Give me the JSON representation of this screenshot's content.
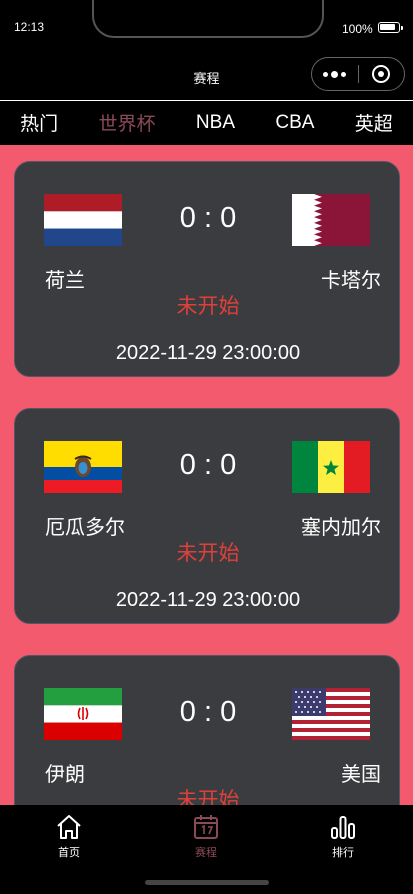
{
  "status_bar": {
    "time": "12:13",
    "battery": "100%"
  },
  "nav": {
    "title": "赛程"
  },
  "tabs": [
    {
      "label": "热门",
      "active": false
    },
    {
      "label": "世界杯",
      "active": true
    },
    {
      "label": "NBA",
      "active": false
    },
    {
      "label": "CBA",
      "active": false
    },
    {
      "label": "英超",
      "active": false
    }
  ],
  "matches": [
    {
      "home": "荷兰",
      "away": "卡塔尔",
      "score": "0 : 0",
      "status": "未开始",
      "date": "2022-11-29 23:00:00",
      "home_flag": "netherlands-flag-icon",
      "away_flag": "qatar-flag-icon"
    },
    {
      "home": "厄瓜多尔",
      "away": "塞内加尔",
      "score": "0 : 0",
      "status": "未开始",
      "date": "2022-11-29 23:00:00",
      "home_flag": "ecuador-flag-icon",
      "away_flag": "senegal-flag-icon"
    },
    {
      "home": "伊朗",
      "away": "美国",
      "score": "0 : 0",
      "status": "未开始",
      "date": "",
      "home_flag": "iran-flag-icon",
      "away_flag": "usa-flag-icon"
    }
  ],
  "tabbar": {
    "items": [
      {
        "label": "首页",
        "icon": "home-icon",
        "active": false
      },
      {
        "label": "赛程",
        "icon": "calendar-icon",
        "active": true
      },
      {
        "label": "排行",
        "icon": "ranking-icon",
        "active": false
      }
    ]
  },
  "colors": {
    "background": "#000000",
    "content_bg": "#f45a6e",
    "card_bg": "#3b3c3f",
    "status_red": "#e0403a",
    "active_tab": "#8b4a58"
  }
}
